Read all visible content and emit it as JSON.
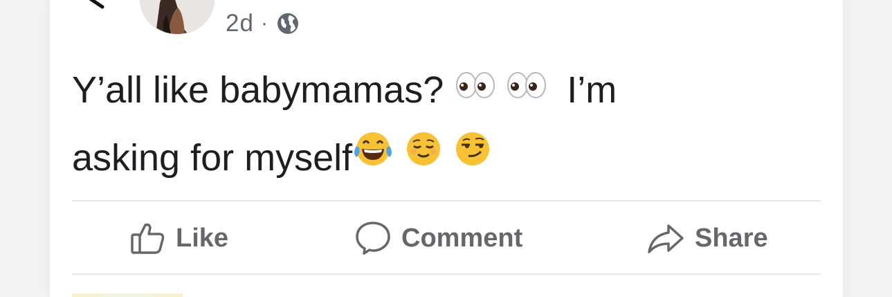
{
  "post": {
    "timestamp": "2d",
    "separator": "·",
    "audience_icon": "globe-icon",
    "text_line1": "Y’all like babymamas?",
    "text_line1_end": "I’m",
    "text_line2": "asking for myself",
    "emojis": [
      "eyes-emoji",
      "eyes-emoji",
      "tears-of-joy-emoji",
      "relieved-face-emoji",
      "smirking-face-emoji"
    ]
  },
  "actions": {
    "like_label": "Like",
    "comment_label": "Comment",
    "share_label": "Share",
    "like_icon": "thumbs-up-icon",
    "comment_icon": "speech-bubble-icon",
    "share_icon": "share-arrow-icon"
  },
  "colors": {
    "text": "#1c1e21",
    "secondary_text": "#606770",
    "action_text": "#65676b",
    "divider": "#e4e6ea",
    "emoji_yellow": "#f7c234"
  }
}
